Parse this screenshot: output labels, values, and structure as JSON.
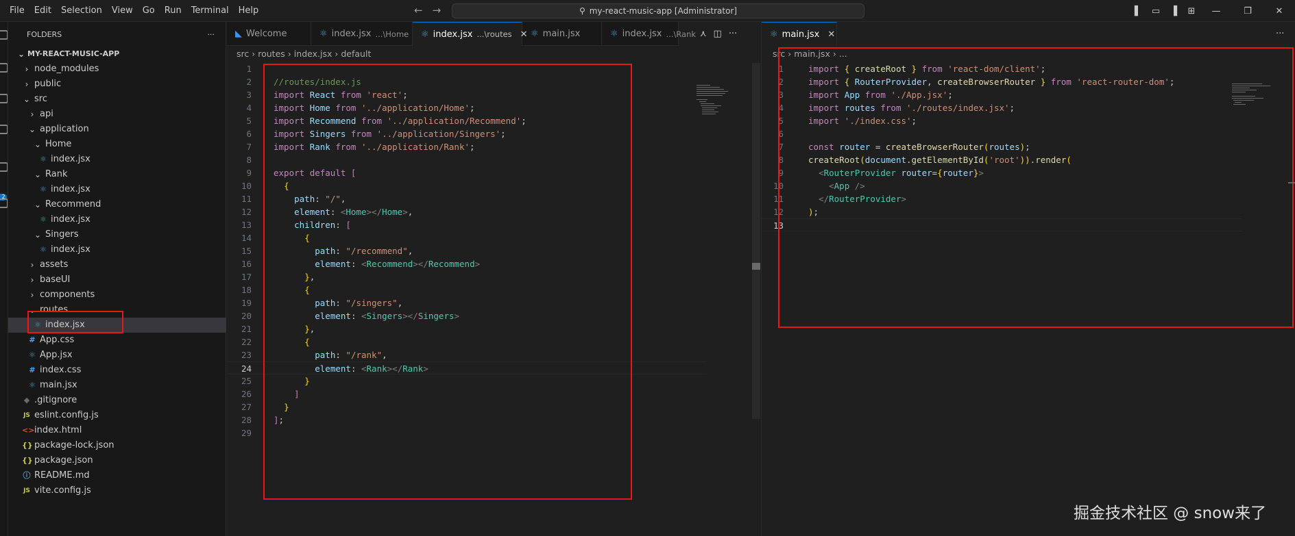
{
  "menu": [
    "File",
    "Edit",
    "Selection",
    "View",
    "Go",
    "Run",
    "Terminal",
    "Help"
  ],
  "command_center": "my-react-music-app [Administrator]",
  "sidebar": {
    "header": "FOLDERS",
    "root": "MY-REACT-MUSIC-APP",
    "items": [
      {
        "label": "node_modules",
        "chev": "›",
        "icon": ""
      },
      {
        "label": "public",
        "chev": "›",
        "icon": ""
      },
      {
        "label": "src",
        "chev": "⌄",
        "icon": ""
      },
      {
        "label": "api",
        "chev": "›",
        "icon": ""
      },
      {
        "label": "application",
        "chev": "⌄",
        "icon": ""
      },
      {
        "label": "Home",
        "chev": "⌄",
        "icon": ""
      },
      {
        "label": "index.jsx",
        "chev": "",
        "icon": "⚛"
      },
      {
        "label": "Rank",
        "chev": "⌄",
        "icon": ""
      },
      {
        "label": "index.jsx",
        "chev": "",
        "icon": "⚛"
      },
      {
        "label": "Recommend",
        "chev": "⌄",
        "icon": ""
      },
      {
        "label": "index.jsx",
        "chev": "",
        "icon": "⚛"
      },
      {
        "label": "Singers",
        "chev": "⌄",
        "icon": ""
      },
      {
        "label": "index.jsx",
        "chev": "",
        "icon": "⚛"
      },
      {
        "label": "assets",
        "chev": "›",
        "icon": ""
      },
      {
        "label": "baseUI",
        "chev": "›",
        "icon": ""
      },
      {
        "label": "components",
        "chev": "›",
        "icon": ""
      },
      {
        "label": "routes",
        "chev": "⌄",
        "icon": ""
      },
      {
        "label": "index.jsx",
        "chev": "",
        "icon": "⚛"
      },
      {
        "label": "App.css",
        "chev": "",
        "icon": "#"
      },
      {
        "label": "App.jsx",
        "chev": "",
        "icon": "⚛"
      },
      {
        "label": "index.css",
        "chev": "",
        "icon": "#"
      },
      {
        "label": "main.jsx",
        "chev": "",
        "icon": "⚛"
      },
      {
        "label": ".gitignore",
        "chev": "",
        "icon": "◆"
      },
      {
        "label": "eslint.config.js",
        "chev": "",
        "icon": "JS"
      },
      {
        "label": "index.html",
        "chev": "",
        "icon": "<>"
      },
      {
        "label": "package-lock.json",
        "chev": "",
        "icon": "{}"
      },
      {
        "label": "package.json",
        "chev": "",
        "icon": "{}"
      },
      {
        "label": "README.md",
        "chev": "",
        "icon": "ⓘ"
      },
      {
        "label": "vite.config.js",
        "chev": "",
        "icon": "JS"
      }
    ]
  },
  "editor1": {
    "tabs": [
      {
        "label": "Welcome",
        "desc": ""
      },
      {
        "label": "index.jsx",
        "desc": "...\\Home"
      },
      {
        "label": "index.jsx",
        "desc": "...\\routes"
      },
      {
        "label": "main.jsx",
        "desc": ""
      },
      {
        "label": "index.jsx",
        "desc": "...\\Rank"
      }
    ],
    "breadcrumb": [
      "src",
      "routes",
      "index.jsx",
      "default"
    ]
  },
  "editor2": {
    "tabs": [
      {
        "label": "main.jsx",
        "desc": ""
      }
    ],
    "breadcrumb": [
      "src",
      "main.jsx",
      "..."
    ]
  },
  "code1": [
    "",
    "//routes/index.js",
    "import React from 'react';",
    "import Home from '../application/Home';",
    "import Recommend from '../application/Recommend';",
    "import Singers from '../application/Singers';",
    "import Rank from '../application/Rank';",
    "",
    "export default [",
    "  {",
    "    path: \"/\",",
    "    element: <Home></Home>,",
    "    children: [",
    "      {",
    "        path: \"/recommend\",",
    "        element: <Recommend></Recommend>",
    "      },",
    "      {",
    "        path: \"/singers\",",
    "        element: <Singers></Singers>",
    "      },",
    "      {",
    "        path: \"/rank\",",
    "        element: <Rank></Rank>",
    "      }",
    "    ]",
    "  }",
    "];",
    ""
  ],
  "code2": [
    "import { createRoot } from 'react-dom/client';",
    "import { RouterProvider, createBrowserRouter } from 'react-router-dom';",
    "import App from './App.jsx';",
    "import routes from './routes/index.jsx';",
    "import './index.css';",
    "",
    "const router = createBrowserRouter(routes);",
    "createRoot(document.getElementById('root')).render(",
    "  <RouterProvider router={router}>",
    "    <App />",
    "  </RouterProvider>",
    ");",
    ""
  ],
  "watermark": "掘金技术社区 @ snow来了"
}
